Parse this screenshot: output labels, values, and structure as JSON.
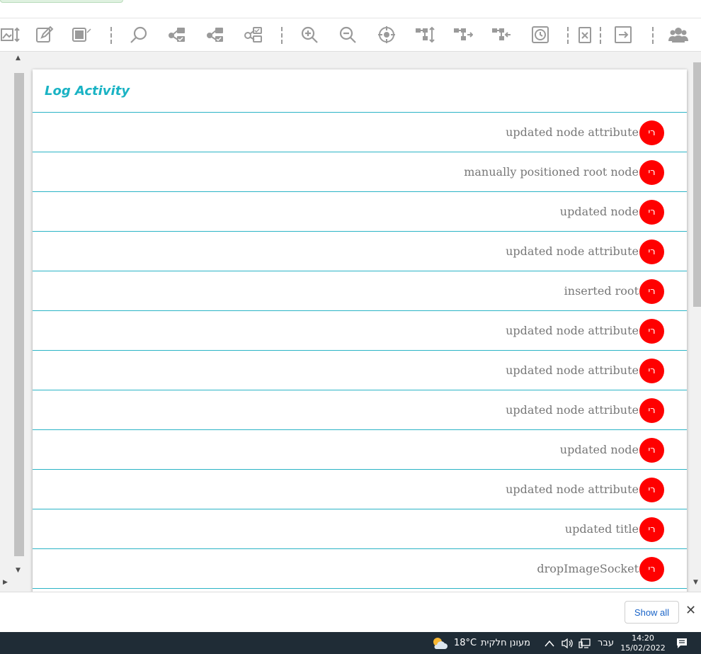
{
  "panel": {
    "title": "Log Activity",
    "entries": [
      {
        "text": "updated node attribute",
        "avatar": "רי"
      },
      {
        "text": "manually positioned root node",
        "avatar": "רי"
      },
      {
        "text": "updated node",
        "avatar": "רי"
      },
      {
        "text": "updated node attribute",
        "avatar": "רי"
      },
      {
        "text": "inserted root",
        "avatar": "רי"
      },
      {
        "text": "updated node attribute",
        "avatar": "רי"
      },
      {
        "text": "updated node attribute",
        "avatar": "רי"
      },
      {
        "text": "updated node attribute",
        "avatar": "רי"
      },
      {
        "text": "updated node",
        "avatar": "רי"
      },
      {
        "text": "updated node attribute",
        "avatar": "רי"
      },
      {
        "text": "updated title",
        "avatar": "רי"
      },
      {
        "text": "dropImageSocket",
        "avatar": "רי"
      }
    ]
  },
  "download_bar": {
    "show_all": "Show all",
    "close": "✕"
  },
  "taskbar": {
    "temperature": "18°C",
    "weather": "מעונן חלקית",
    "language": "עבר",
    "time": "14:20",
    "date": "15/02/2022"
  },
  "colors": {
    "accent": "#1ab3c4",
    "row_border": "#2bb4c6",
    "avatar": "#ff0000",
    "toolbar_icon": "#9a9a9a",
    "taskbar": "#1f2c36"
  },
  "toolbar_icons": [
    "image-resize-icon",
    "edit-icon",
    "image-attach-icon",
    "search-icon",
    "node-check-icon",
    "node-check-icon",
    "node-check-icon",
    "zoom-in-icon",
    "zoom-out-icon",
    "crosshair-icon",
    "tree-vertical-icon",
    "tree-right-icon",
    "tree-left-icon",
    "history-icon",
    "close-document-icon",
    "exit-icon",
    "users-icon"
  ]
}
